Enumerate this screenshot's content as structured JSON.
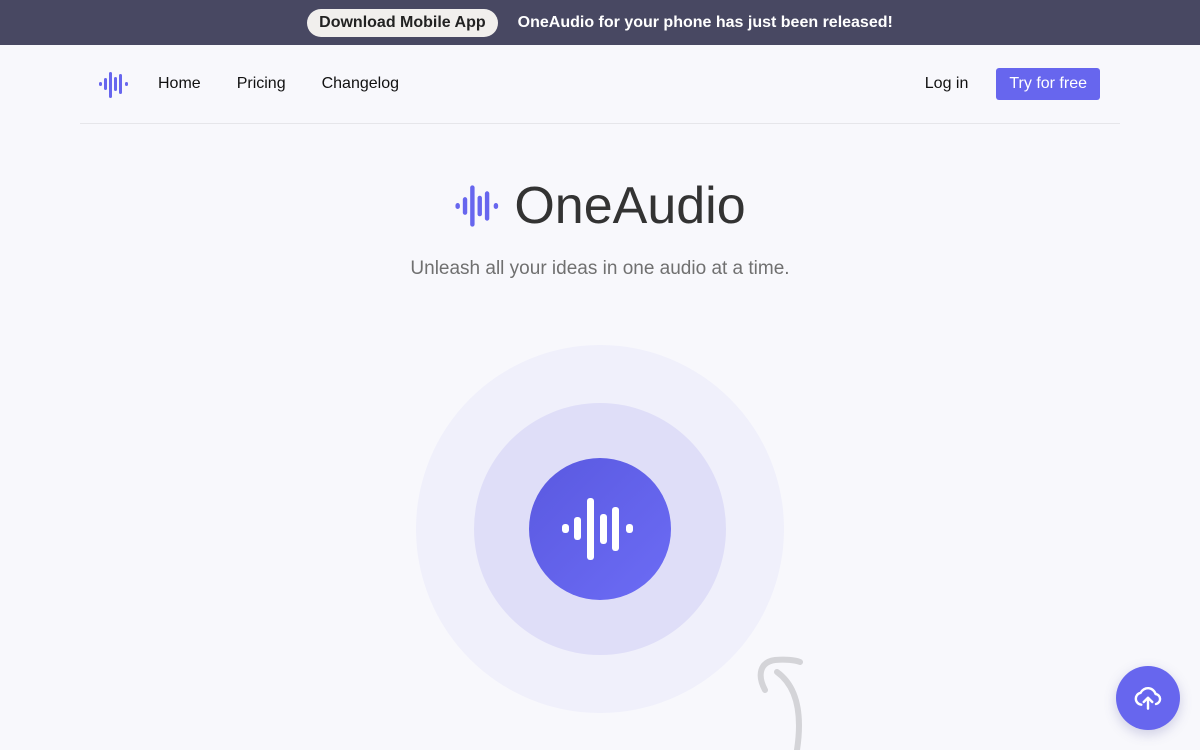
{
  "banner": {
    "button_label": "Download Mobile App",
    "message": "OneAudio for your phone has just been released!"
  },
  "nav": {
    "logo_icon": "audio-wave-icon",
    "links": [
      {
        "label": "Home"
      },
      {
        "label": "Pricing"
      },
      {
        "label": "Changelog"
      }
    ],
    "login_label": "Log in",
    "cta_label": "Try for free"
  },
  "hero": {
    "logo_icon": "audio-wave-icon",
    "title": "OneAudio",
    "subtitle": "Unleash all your ideas in one audio at a time."
  },
  "recorder": {
    "icon": "audio-wave-icon"
  },
  "fab": {
    "icon": "cloud-upload-icon"
  },
  "colors": {
    "accent": "#6766ee",
    "banner_bg": "#484862",
    "page_bg": "#f8f8fc"
  }
}
